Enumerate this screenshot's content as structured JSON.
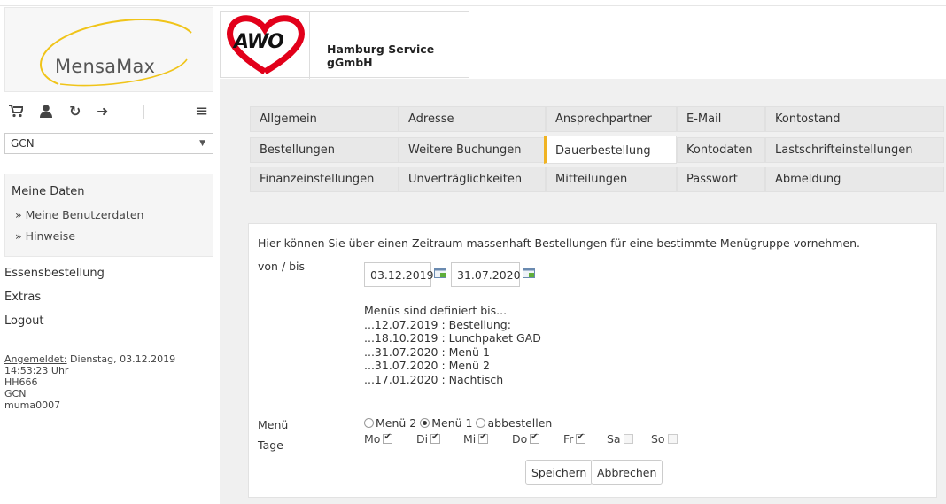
{
  "app": {
    "logo_text": "MensaMax",
    "org_logo_word": "AWO",
    "org_name": "Hamburg Service gGmbH"
  },
  "icons": [
    "cart-icon",
    "user-icon",
    "refresh-icon",
    "logout-icon",
    "menu-icon"
  ],
  "select": {
    "value": "GCN"
  },
  "sidebar": {
    "section_title": "Meine Daten",
    "section_items": [
      "» Meine Benutzerdaten",
      "» Hinweise"
    ],
    "nav": [
      "Essensbestellung",
      "Extras",
      "Logout"
    ],
    "login_label": "Angemeldet:",
    "login_date": " Dienstag, 03.12.2019",
    "login_time": "14:53:23 Uhr",
    "login_lines": [
      "HH666",
      "GCN",
      "muma0007"
    ]
  },
  "tabs": [
    [
      "Allgemein",
      "Adresse",
      "Ansprechpartner",
      "E-Mail",
      "Kontostand"
    ],
    [
      "Bestellungen",
      "Weitere Buchungen",
      "Dauerbestellung",
      "Kontodaten",
      "Lastschrifteinstellungen"
    ],
    [
      "Finanzeinstellungen",
      "Unverträglichkeiten",
      "Mitteilungen",
      "Passwort",
      "Abmeldung"
    ]
  ],
  "active_tab": "Dauerbestellung",
  "form": {
    "intro": "Hier können Sie über einen Zeitraum massenhaft Bestellungen für eine bestimmte Menügruppe vornehmen.",
    "range_label": "von / bis",
    "date_from": "03.12.2019",
    "date_to": "31.07.2020",
    "menus_title": "Menüs sind definiert bis...",
    "menus_lines": [
      "...12.07.2019 : Bestellung:",
      "...18.10.2019 : Lunchpaket GAD",
      "...31.07.2020 : Menü 1",
      "...31.07.2020 : Menü 2",
      "...17.01.2020 : Nachtisch"
    ],
    "menu_label": "Menü",
    "menu_options": [
      "Menü 2",
      "Menü 1",
      "abbestellen"
    ],
    "menu_selected": "Menü 1",
    "days_label": "Tage",
    "days": [
      {
        "label": "Mo",
        "checked": true
      },
      {
        "label": "Di",
        "checked": true
      },
      {
        "label": "Mi",
        "checked": true
      },
      {
        "label": "Do",
        "checked": true
      },
      {
        "label": "Fr",
        "checked": true
      },
      {
        "label": "Sa",
        "checked": false
      },
      {
        "label": "So",
        "checked": false
      }
    ],
    "save_label": "Speichern",
    "cancel_label": "Abbrechen"
  },
  "colors": {
    "active_tab_accent": "#f0b323",
    "awo_red": "#e2001a",
    "logo_swoosh": "#f0c419"
  }
}
